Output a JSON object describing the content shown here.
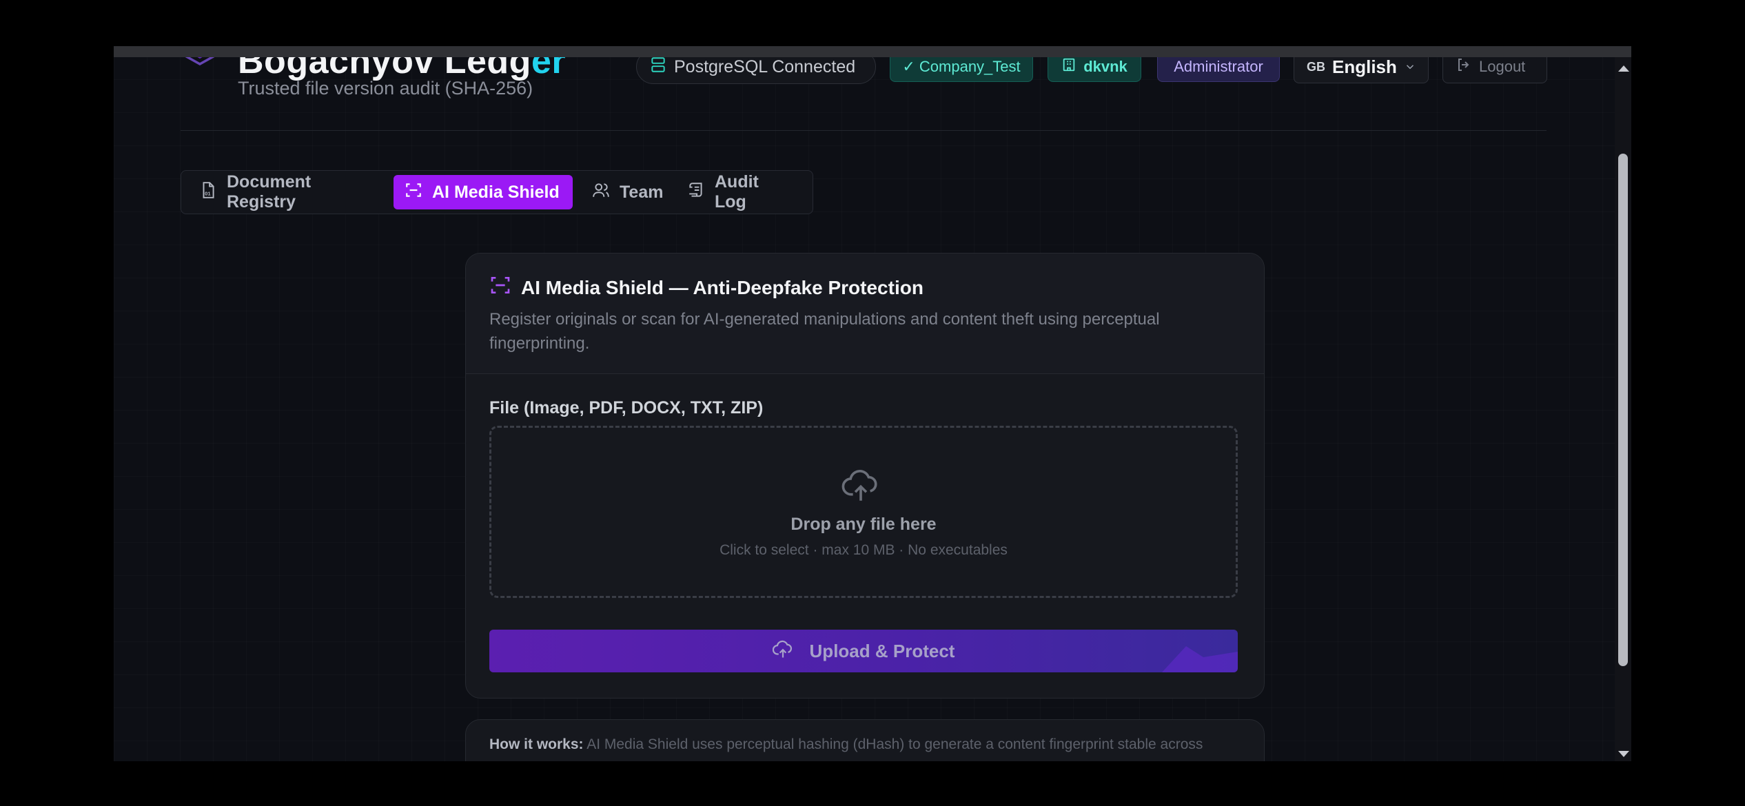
{
  "header": {
    "brand_main": "Bogachyov Ledg",
    "brand_accent": "er",
    "subtitle": "Trusted file version audit (SHA-256)",
    "db_status": "PostgreSQL Connected",
    "company_badge": "✓ Company_Test",
    "user_badge": "dkvnk",
    "role_badge": "Administrator",
    "language_flag": "GB",
    "language": "English",
    "logout": "Logout"
  },
  "tabs": [
    {
      "label": "Document Registry",
      "icon": "document-icon"
    },
    {
      "label": "AI Media Shield",
      "icon": "scan-icon",
      "active": true
    },
    {
      "label": "Team",
      "icon": "users-icon"
    },
    {
      "label": "Audit Log",
      "icon": "scroll-icon"
    }
  ],
  "card": {
    "title": "AI Media Shield — Anti-Deepfake Protection",
    "description": "Register originals or scan for AI-generated manipulations and content theft using perceptual fingerprinting.",
    "field_label": "File (Image, PDF, DOCX, TXT, ZIP)",
    "dropzone_title": "Drop any file here",
    "dropzone_sub": "Click to select · max 10 MB · No executables",
    "button_label": "Upload & Protect"
  },
  "how_it_works": {
    "label": "How it works:",
    "text": "AI Media Shield uses perceptual hashing (dHash) to generate a content fingerprint stable across"
  },
  "colors": {
    "accent_purple": "#9b19f5",
    "teal": "#5eead4",
    "brand_accent": "#22d3ee"
  }
}
